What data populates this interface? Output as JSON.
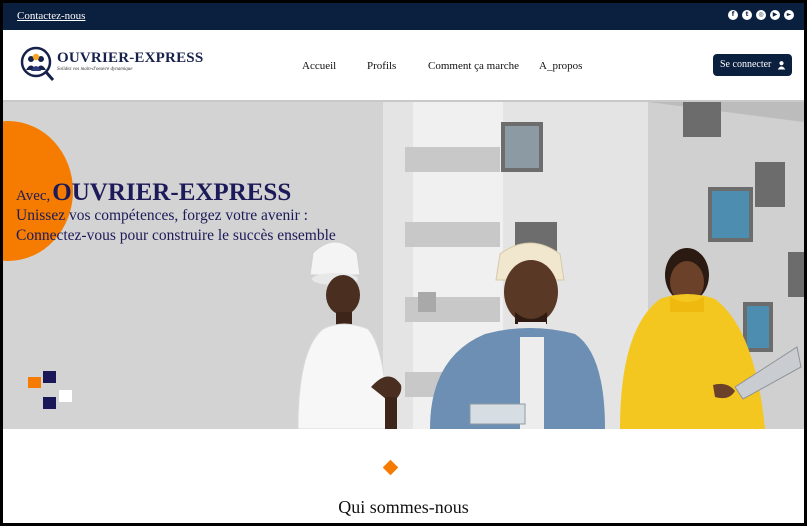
{
  "topbar": {
    "contact_label": "Contactez-nous",
    "social_icons": [
      "facebook-icon",
      "twitter-icon",
      "instagram-icon",
      "youtube-icon",
      "play-icon"
    ]
  },
  "header": {
    "brand": "OUVRIER-EXPRESS",
    "tagline": "Solidez vos main-d'oeuvre dynamique",
    "nav": [
      "Accueil",
      "Profils",
      "Comment ça marche",
      "A_propos"
    ],
    "login_label": "Se connecter"
  },
  "hero": {
    "avec": "Avec,",
    "brand": "OUVRIER-EXPRESS",
    "slogan": "Unissez vos compétences, forgez votre avenir : Connectez-vous pour construire le succès ensemble"
  },
  "section": {
    "title": "Qui sommes-nous"
  },
  "colors": {
    "navy": "#0b1f3f",
    "brand_text": "#1c1a58",
    "accent": "#f57c00"
  }
}
